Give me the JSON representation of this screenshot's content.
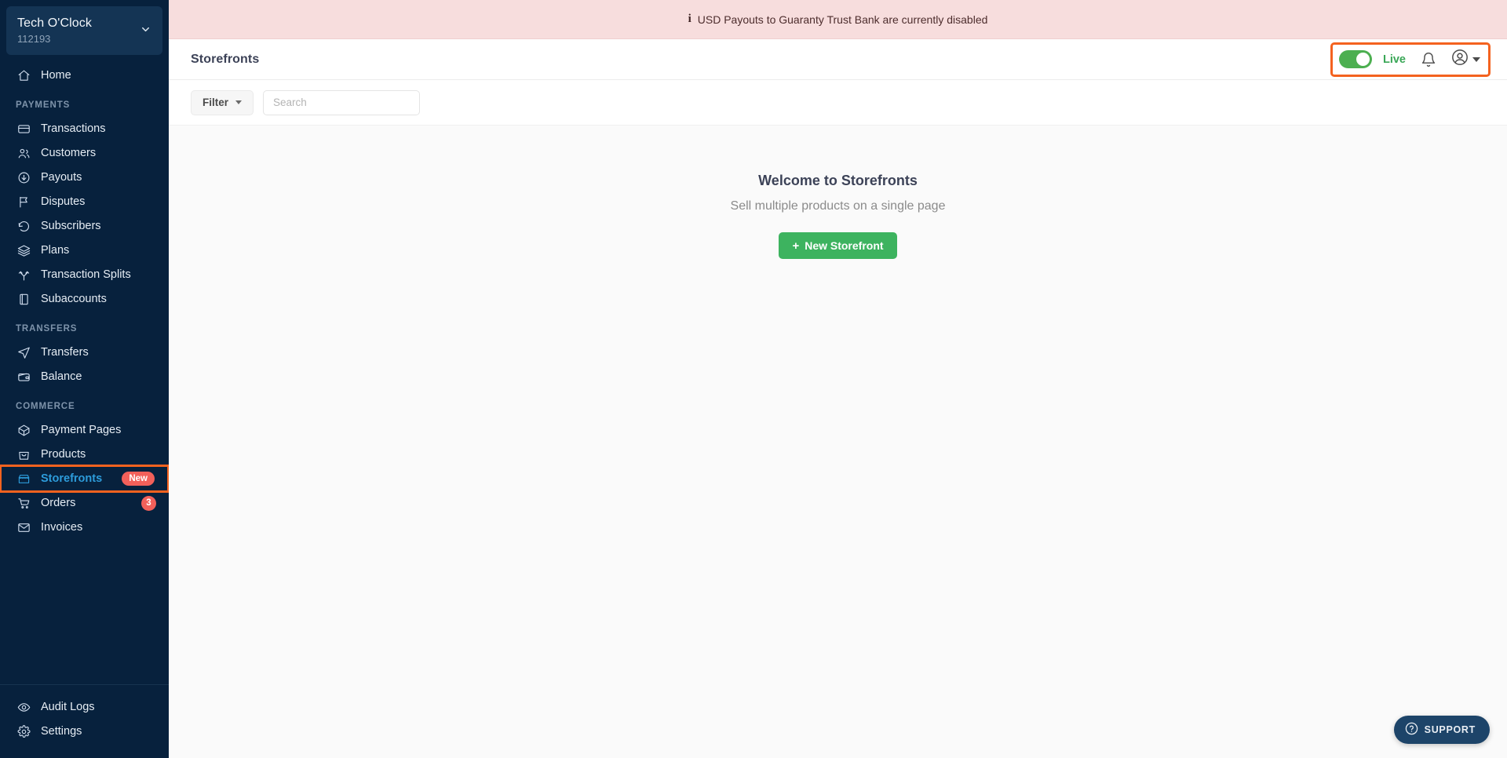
{
  "sidebar": {
    "org": {
      "name": "Tech O'Clock",
      "id": "112193",
      "chevron_icon": "chevron-down-icon"
    },
    "top_items": [
      {
        "label": "Home",
        "icon": "home-icon",
        "key": "home"
      }
    ],
    "sections": [
      {
        "title": "PAYMENTS",
        "items": [
          {
            "label": "Transactions",
            "icon": "card-icon",
            "key": "transactions"
          },
          {
            "label": "Customers",
            "icon": "users-icon",
            "key": "customers"
          },
          {
            "label": "Payouts",
            "icon": "arrow-down-circle-icon",
            "key": "payouts"
          },
          {
            "label": "Disputes",
            "icon": "flag-icon",
            "key": "disputes"
          },
          {
            "label": "Subscribers",
            "icon": "refresh-icon",
            "key": "subscribers"
          },
          {
            "label": "Plans",
            "icon": "layers-icon",
            "key": "plans"
          },
          {
            "label": "Transaction Splits",
            "icon": "split-icon",
            "key": "transaction-splits"
          },
          {
            "label": "Subaccounts",
            "icon": "book-icon",
            "key": "subaccounts"
          }
        ]
      },
      {
        "title": "TRANSFERS",
        "items": [
          {
            "label": "Transfers",
            "icon": "send-icon",
            "key": "transfers"
          },
          {
            "label": "Balance",
            "icon": "wallet-icon",
            "key": "balance"
          }
        ]
      },
      {
        "title": "COMMERCE",
        "items": [
          {
            "label": "Payment Pages",
            "icon": "package-icon",
            "key": "payment-pages"
          },
          {
            "label": "Products",
            "icon": "bag-icon",
            "key": "products"
          },
          {
            "label": "Storefronts",
            "icon": "storefront-icon",
            "key": "storefronts",
            "badge": "New",
            "badge_type": "new",
            "active": true,
            "highlighted": true
          },
          {
            "label": "Orders",
            "icon": "cart-icon",
            "key": "orders",
            "badge": "3",
            "badge_type": "count"
          },
          {
            "label": "Invoices",
            "icon": "mail-icon",
            "key": "invoices"
          }
        ]
      }
    ],
    "bottom_items": [
      {
        "label": "Audit Logs",
        "icon": "eye-icon",
        "key": "audit-logs"
      },
      {
        "label": "Settings",
        "icon": "gear-icon",
        "key": "settings"
      }
    ]
  },
  "banner": {
    "icon": "info-icon",
    "text": "USD Payouts to Guaranty Trust Bank are currently disabled"
  },
  "header": {
    "title": "Storefronts",
    "mode_toggle": {
      "label": "Live",
      "state": "on"
    },
    "notifications_icon": "bell-icon",
    "account_icon": "user-circle-icon",
    "account_caret_icon": "caret-down-icon"
  },
  "filters": {
    "filter_label": "Filter",
    "filter_caret_icon": "caret-down-icon",
    "search_placeholder": "Search",
    "search_value": ""
  },
  "empty_state": {
    "title": "Welcome to Storefronts",
    "subtitle": "Sell multiple products on a single page",
    "cta_label": "New Storefront",
    "cta_plus": "+"
  },
  "support": {
    "label": "SUPPORT",
    "icon": "question-circle-icon"
  },
  "colors": {
    "sidebar_bg": "#07213d",
    "accent_blue": "#2d9cdb",
    "highlight_orange": "#f4621f",
    "badge_red": "#f2605a",
    "green": "#3db35f",
    "banner_bg": "#f7dddd"
  }
}
